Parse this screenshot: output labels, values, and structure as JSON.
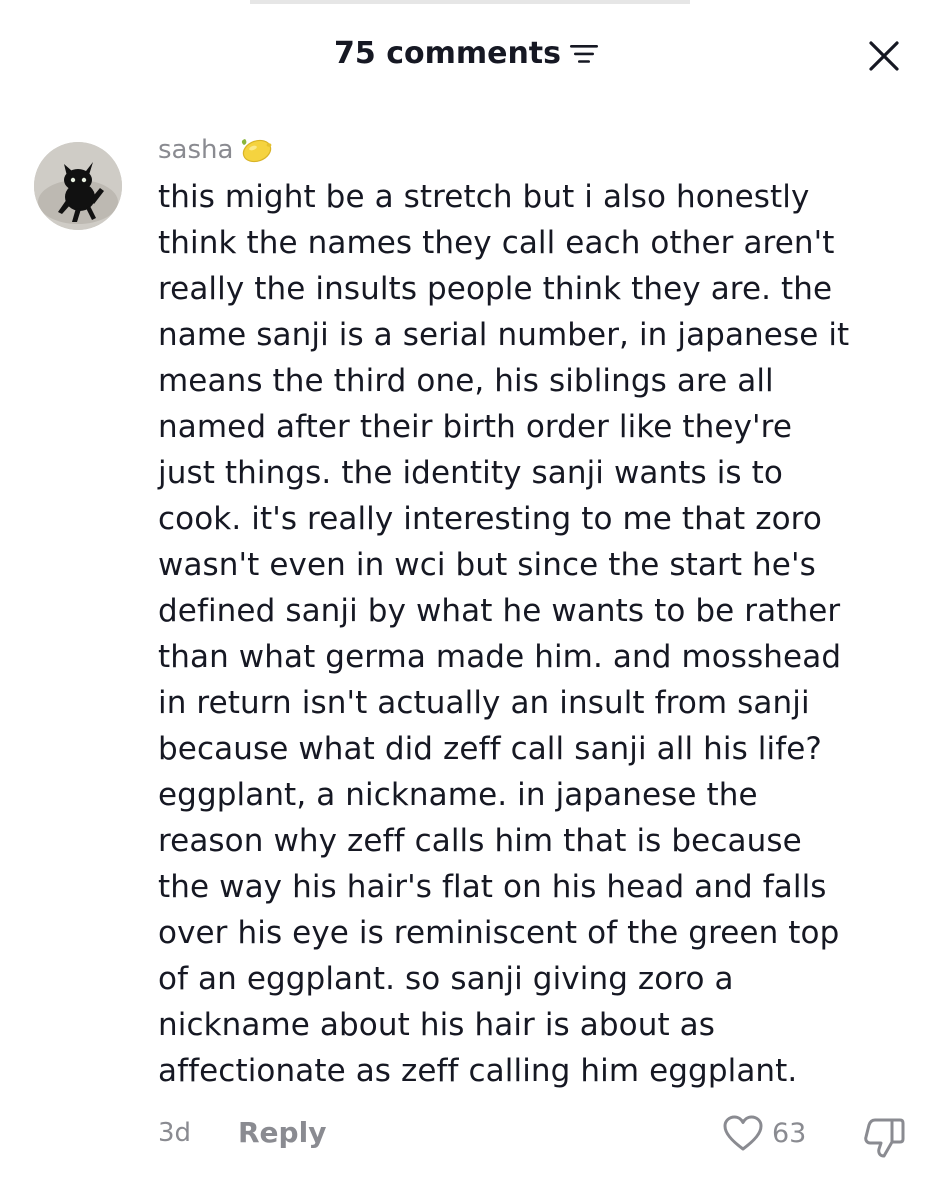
{
  "header": {
    "title": "75 comments",
    "sort_icon": "sort-lines-icon",
    "close_icon": "close-icon"
  },
  "comment": {
    "avatar_icon": "black-cat-avatar",
    "username": "sasha",
    "username_badge_icon": "lemon-emoji-icon",
    "text": "this might be a stretch but i also honestly\nthink the names they call each other aren't\nreally the insults people think they are. the\nname sanji is a serial number, in japanese it\nmeans the third one, his siblings are all\nnamed after their birth order like they're\njust things. the identity sanji wants is to\ncook. it's really interesting to me that zoro\nwasn't even in wci but since the start he's\ndefined sanji by what he wants to be rather\nthan what germa made him. and mosshead\nin return isn't actually an insult from sanji\nbecause what did zeff call sanji all his life?\neggplant, a nickname. in japanese the\nreason why zeff calls him that is because\nthe way his hair's flat on his head and falls\nover his eye is reminiscent of the green top\nof an eggplant. so sanji giving zoro a\nnickname about his hair is about as\naffectionate as zeff calling him eggplant.",
    "age": "3d",
    "reply_label": "Reply",
    "like_icon": "heart-outline-icon",
    "like_count": "63",
    "dislike_icon": "thumbs-down-icon"
  },
  "colors": {
    "text_primary": "#161823",
    "text_secondary": "#8a8b91",
    "background": "#ffffff"
  }
}
